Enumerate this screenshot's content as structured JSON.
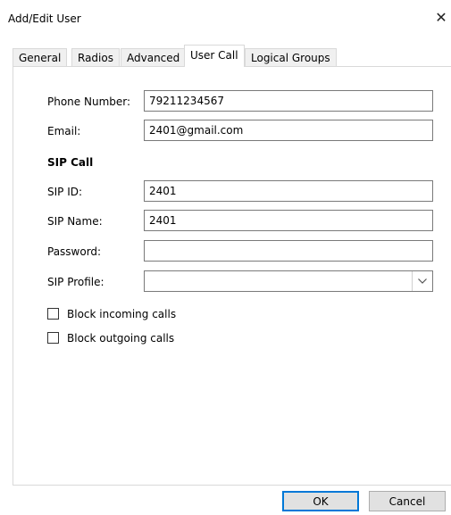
{
  "window": {
    "title": "Add/Edit User",
    "close_glyph": "✕"
  },
  "tabs": [
    {
      "label": "General",
      "active": false
    },
    {
      "label": "Radios",
      "active": false
    },
    {
      "label": "Advanced",
      "active": false
    },
    {
      "label": "User Call",
      "active": true
    },
    {
      "label": "Logical Groups",
      "active": false
    }
  ],
  "form": {
    "phone_label": "Phone Number:",
    "phone_value": "79211234567",
    "email_label": "Email:",
    "email_value": "2401@gmail.com",
    "sip_section": "SIP Call",
    "sip_id_label": "SIP ID:",
    "sip_id_value": "2401",
    "sip_name_label": "SIP Name:",
    "sip_name_value": "2401",
    "password_label": "Password:",
    "password_value": "",
    "sip_profile_label": "SIP Profile:",
    "sip_profile_value": "",
    "block_incoming_label": "Block incoming calls",
    "block_incoming_checked": false,
    "block_outgoing_label": "Block outgoing calls",
    "block_outgoing_checked": false
  },
  "buttons": {
    "ok_label": "OK",
    "cancel_label": "Cancel"
  },
  "icons": {
    "close": "close-icon",
    "dropdown": "chevron-down-icon"
  },
  "colors": {
    "default_button_border": "#0078d7",
    "button_bg": "#e1e1e1",
    "tab_bg": "#f0f0f0"
  }
}
